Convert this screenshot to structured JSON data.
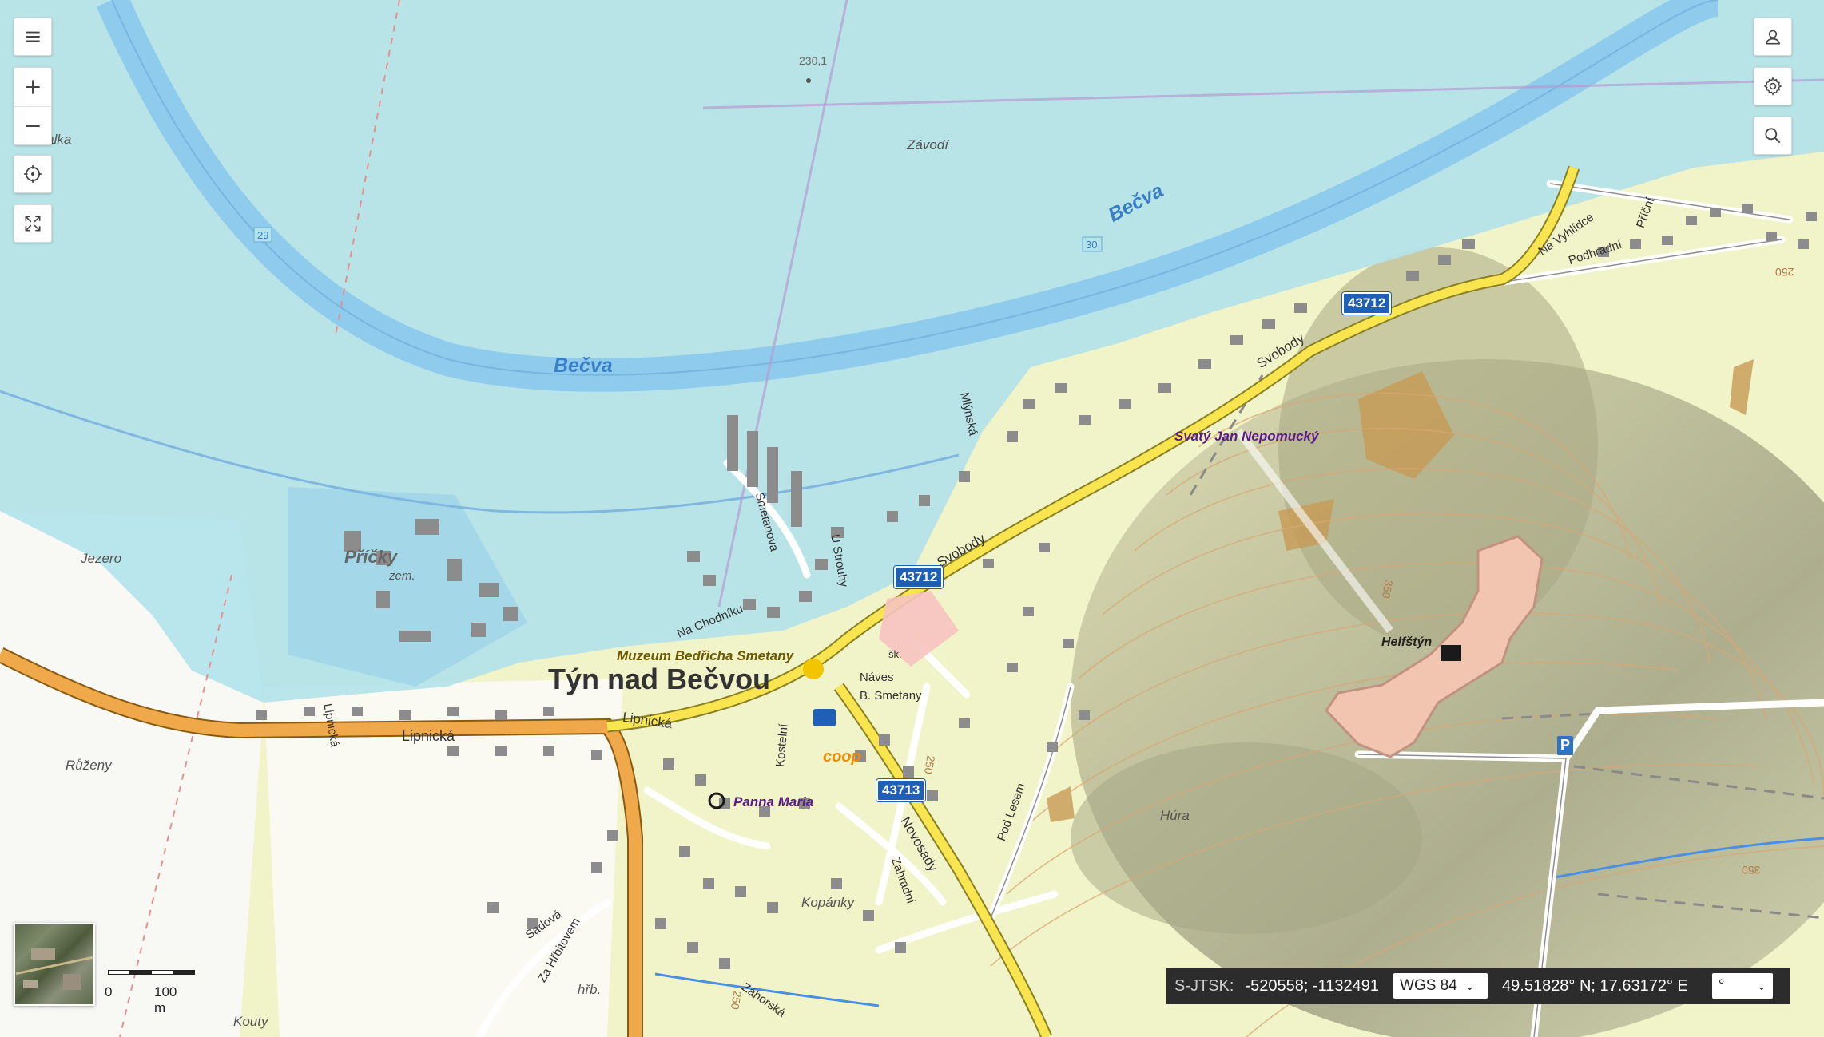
{
  "map": {
    "water_labels": [
      "Bečva",
      "Bečva"
    ],
    "place_labels": {
      "zavodi": "Závodí",
      "pricky": "Příčky",
      "zem": "zem.",
      "jezero": "Jezero",
      "ruzeny": "Růženy",
      "hura": "Húra",
      "kopanky": "Kopánky",
      "hrb": "hřb.",
      "kouty": "Kouty",
      "stalka": "...alka"
    },
    "town_label": "Týn nad Bečvou",
    "street_labels": {
      "lipnicka1": "Lipnická",
      "lipnicka2": "Lipnická",
      "lipnicka3": "Lipnická",
      "svobody1": "Svobody",
      "svobody2": "Svobody",
      "novosady": "Novosady",
      "zahradni": "Zahradní",
      "kostelni": "Kostelní",
      "smetanova": "Smetanova",
      "u_strouhy": "U Strouhy",
      "na_chodniku": "Na Chodníku",
      "mlynska": "Mlýnská",
      "pod_lesem": "Pod Lesem",
      "na_vyhlidce": "Na Vyhlídce",
      "pricni": "Příční",
      "podhradni": "Podhradní",
      "sadova": "Sadová",
      "za_hrbitovem": "Za Hřbitovem",
      "zahorska": "Záhorská",
      "naves": "Náves",
      "b_smetany": "B. Smetany",
      "sk": "šk."
    },
    "poi_labels": {
      "muzeum": "Muzeum Bedřicha Smetany",
      "jan_nepomucky": "Svatý Jan Nepomucký",
      "panna_maria": "Panna Maria",
      "helfstyn": "Helfštýn",
      "coop": "coop",
      "parking": "P"
    },
    "road_numbers": [
      "43712",
      "43712",
      "43713"
    ],
    "elevation_labels": [
      "230,1",
      "250",
      "250",
      "350",
      "350",
      "250"
    ],
    "km_markers": [
      "29",
      "30"
    ],
    "colors": {
      "water_overlay": "#b3e3ea",
      "river": "#8ecbed",
      "land": "#f1f3c8",
      "road_main": "#f0a94a",
      "road_secondary": "#f8e550",
      "building": "#8c8c8c",
      "castle": "#f1c5b0"
    }
  },
  "toolbar": {
    "menu_icon": "hamburger-icon",
    "zoom_in_icon": "plus-icon",
    "zoom_out_icon": "minus-icon",
    "locate_icon": "crosshair-icon",
    "fullscreen_icon": "expand-icon",
    "user_icon": "user-icon",
    "settings_icon": "gear-icon",
    "search_icon": "search-icon"
  },
  "scale_bar": {
    "start": "0",
    "end": "100 m"
  },
  "coordinates": {
    "system_label": "S-JTSK:",
    "system_value": "-520558; -1132491",
    "projection": "WGS 84",
    "wgs_value": "49.51828° N; 17.63172° E",
    "unit": "°"
  }
}
